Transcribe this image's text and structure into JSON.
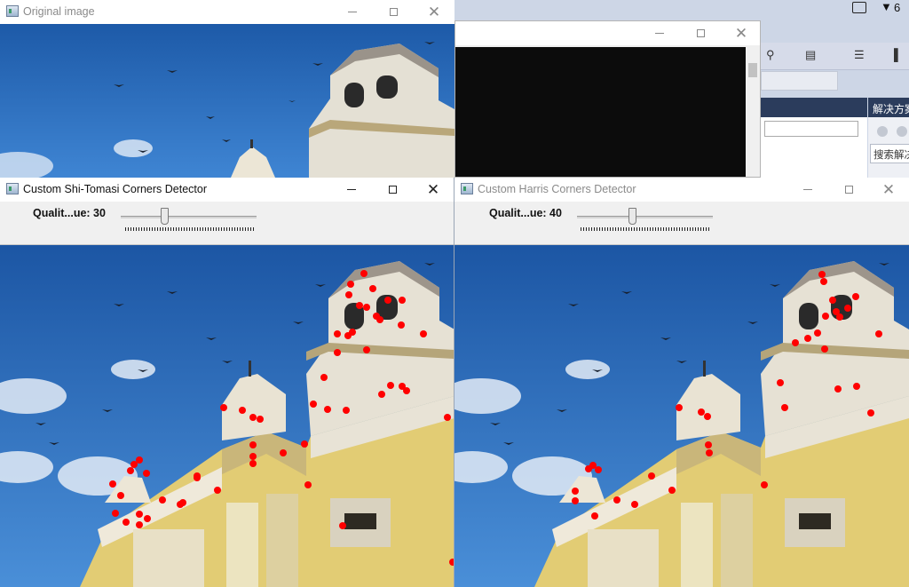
{
  "taskbar": {
    "notification_count": "6"
  },
  "windows": {
    "original": {
      "title": "Original image"
    },
    "console": {
      "title": ""
    },
    "shi_tomasi": {
      "title": "Custom Shi-Tomasi Corners Detector",
      "trackbar_label": "Qualit...ue: 30",
      "trackbar_value": 30,
      "trackbar_max": 100
    },
    "harris": {
      "title": "Custom Harris Corners Detector",
      "trackbar_label": "Qualit...ue: 40",
      "trackbar_value": 40,
      "trackbar_max": 100
    }
  },
  "ide": {
    "solution_explorer_title": "解决方案",
    "search_placeholder": "搜索解决"
  },
  "colors": {
    "corner_marker": "#ff0000",
    "sky": "#2f6fc0",
    "building": "#e3cf78",
    "titlebar": "#ffffff",
    "vs_header": "#2b3c5c"
  }
}
